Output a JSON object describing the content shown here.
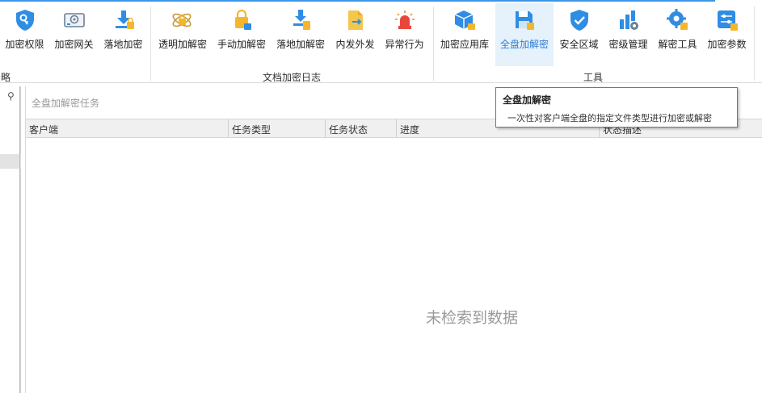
{
  "ribbon": {
    "buttons": [
      {
        "label": "加密权限",
        "icon": "shield-key-icon"
      },
      {
        "label": "加密网关",
        "icon": "gateway-device-icon"
      },
      {
        "label": "落地加密",
        "icon": "download-lock-icon"
      },
      {
        "label": "透明加解密",
        "icon": "atom-lock-icon"
      },
      {
        "label": "手动加解密",
        "icon": "hand-lock-icon"
      },
      {
        "label": "落地加解密",
        "icon": "download-file-lock-icon"
      },
      {
        "label": "内发外发",
        "icon": "file-send-icon"
      },
      {
        "label": "异常行为",
        "icon": "alarm-light-icon"
      },
      {
        "label": "加密应用库",
        "icon": "cube-lock-icon"
      },
      {
        "label": "全盘加解密",
        "icon": "disk-save-lock-icon"
      },
      {
        "label": "安全区域",
        "icon": "shield-check-icon"
      },
      {
        "label": "密级管理",
        "icon": "bar-chart-gear-icon"
      },
      {
        "label": "解密工具",
        "icon": "gear-lock-icon"
      },
      {
        "label": "加密参数",
        "icon": "sliders-lock-icon"
      }
    ],
    "groups": {
      "strategy": "略",
      "log": "文档加密日志",
      "tools": "工具"
    }
  },
  "left_panel": {
    "search_icon": "search-icon"
  },
  "main": {
    "task_title": "全盘加解密任务",
    "columns": [
      "客户端",
      "任务类型",
      "任务状态",
      "进度",
      "状态描述"
    ],
    "empty_text": "未检索到数据"
  },
  "tooltip": {
    "title": "全盘加解密",
    "body": "一次性对客户端全盘的指定文件类型进行加密或解密"
  },
  "colors": {
    "accent": "#3b95e8",
    "icon_blue": "#2f8de4",
    "lock_yellow": "#f5b62d",
    "alarm_red": "#e8473a",
    "active_bg": "#e5f1fb"
  }
}
